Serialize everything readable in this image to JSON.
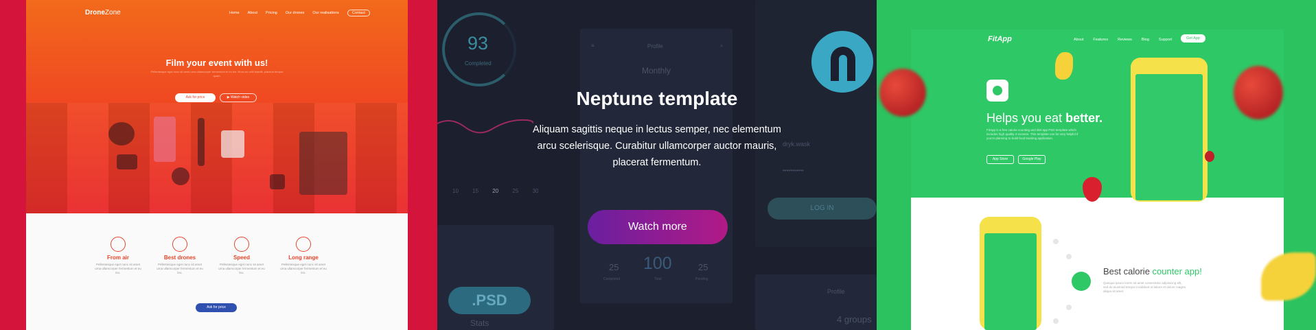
{
  "dronezone": {
    "logo_bold": "Drone",
    "logo_light": "Zone",
    "nav": [
      "Home",
      "About",
      "Pricing",
      "Our drones",
      "Our realisations",
      "Contact"
    ],
    "hero_title": "Film your event with us!",
    "hero_sub": "Pellentesque eget nunc sit amet urna ullamcorper fermentum et eu leo. Nunc eu velit blandit, placerat tempor quam.",
    "btn_ask": "Ask for price",
    "btn_watch": "Watch video",
    "features": [
      {
        "title": "From air",
        "desc": "Pellentesque eget nunc sit amet urna ullamcorper fermentum et eu leo."
      },
      {
        "title": "Best drones",
        "desc": "Pellentesque eget nunc sit amet urna ullamcorper fermentum et eu leo."
      },
      {
        "title": "Speed",
        "desc": "Pellentesque eget nunc sit amet urna ullamcorper fermentum et eu leo."
      },
      {
        "title": "Long range",
        "desc": "Pellentesque eget nunc sit amet urna ullamcorper fermentum et eu leo."
      }
    ],
    "btn_ask_bottom": "Ask for price"
  },
  "neptune": {
    "ring_value": "93",
    "ring_label": "Completed",
    "profile_label": "Profile",
    "monthly_label": "Monthly",
    "axis_ticks": [
      "10",
      "15",
      "20",
      "25",
      "30"
    ],
    "user_field": "dryk.wask",
    "password_mask": "•••••••••••",
    "login_label": "LOG IN",
    "stat_left": "25",
    "stat_left_label": "Completed",
    "stat_mid": "100",
    "stat_mid_label": "Total",
    "stat_right": "25",
    "stat_right_label": "Pending",
    "psd_label": ".PSD",
    "stats_label": "Stats",
    "profile_label_2": "Profile",
    "groups_label": "4 groups",
    "title": "Neptune template",
    "description": "Aliquam sagittis neque in lectus semper, nec elementum arcu scelerisque. Curabitur ullamcorper auctor mauris, placerat fermentum.",
    "watch_more": "Watch more"
  },
  "fitapp": {
    "logo": "FitApp",
    "nav": [
      "About",
      "Features",
      "Reviews",
      "Blog",
      "Support"
    ],
    "get_app": "Get App",
    "headline_light": "Helps you eat ",
    "headline_bold": "better.",
    "hero_desc": "FitApp is a free calorie counting and diet app PSD template which includes high quality 4 screens. This template can be very helpful if you're planning to build food tracking application.",
    "store_1": "App Store",
    "store_2": "Google Play",
    "bottom_title_1": "Best calorie ",
    "bottom_title_2": "counter app!",
    "bottom_desc": "Quisque ipsum lorem sit amet consectetur adipisicing elit, sed do eiusmod tempor incididunt ut labore et dolore magna aliqua sit amet."
  }
}
